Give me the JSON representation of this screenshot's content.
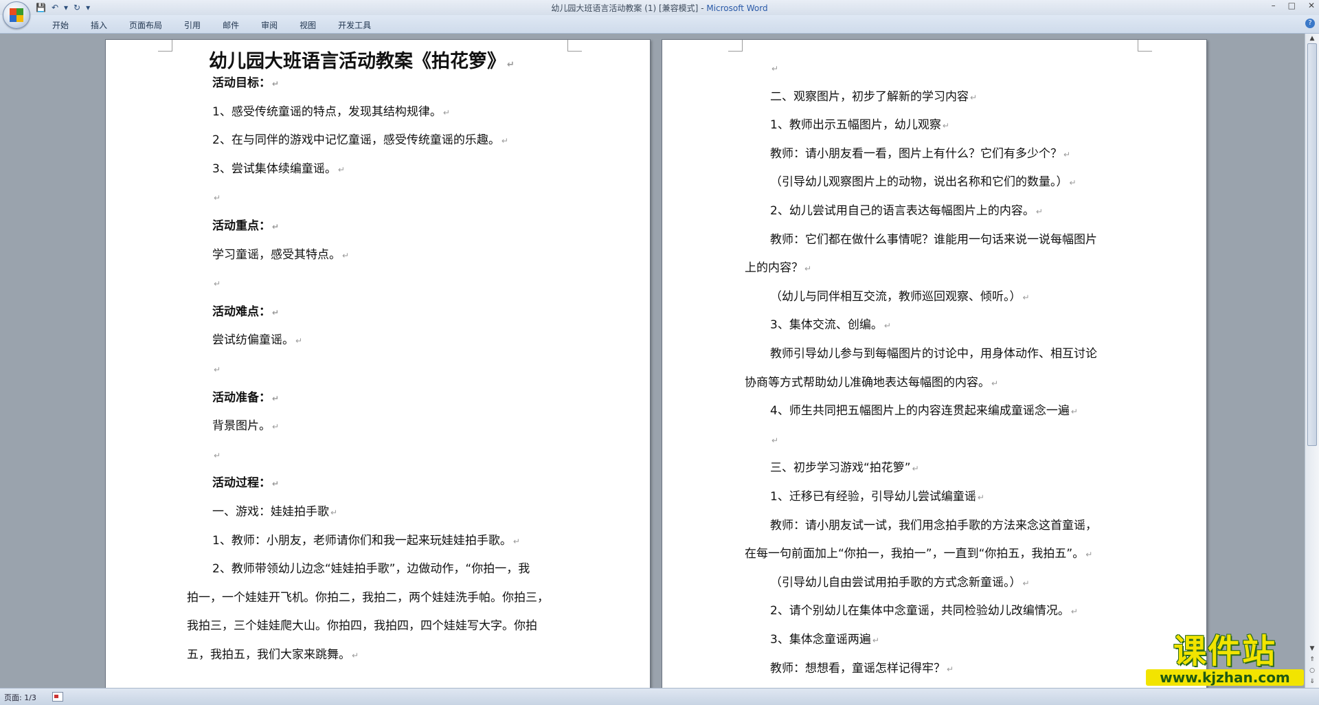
{
  "window": {
    "title": "幼儿园大班语言活动教案 (1) [兼容模式]",
    "title_separator": " - ",
    "app_name": "Microsoft Word",
    "qat": {
      "save_icon": "💾",
      "undo_icon": "↶",
      "undo_drop": "▾",
      "redo_icon": "↻",
      "customize_icon": "▾"
    },
    "controls": {
      "minimize": "–",
      "maximize": "□",
      "close": "✕"
    }
  },
  "ribbon": {
    "tabs": [
      {
        "label": "开始"
      },
      {
        "label": "插入"
      },
      {
        "label": "页面布局"
      },
      {
        "label": "引用"
      },
      {
        "label": "邮件"
      },
      {
        "label": "审阅"
      },
      {
        "label": "视图"
      },
      {
        "label": "开发工具"
      }
    ],
    "help_icon": "?"
  },
  "document": {
    "paragraph_mark": "↵",
    "left_page": {
      "title": "幼儿园大班语言活动教案《拍花箩》",
      "lines": [
        {
          "text": "活动目标：",
          "bold": true
        },
        {
          "text": "1、感受传统童谣的特点，发现其结构规律。"
        },
        {
          "text": "2、在与同伴的游戏中记忆童谣，感受传统童谣的乐趣。"
        },
        {
          "text": "3、尝试集体续编童谣。"
        },
        {
          "text": ""
        },
        {
          "text": "活动重点：",
          "bold": true
        },
        {
          "text": "学习童谣，感受其特点。"
        },
        {
          "text": ""
        },
        {
          "text": "活动难点：",
          "bold": true
        },
        {
          "text": "尝试纺偏童谣。"
        },
        {
          "text": ""
        },
        {
          "text": "活动准备：",
          "bold": true
        },
        {
          "text": "背景图片。"
        },
        {
          "text": ""
        },
        {
          "text": "活动过程：",
          "bold": true
        },
        {
          "text": "一、游戏：娃娃拍手歌"
        },
        {
          "text": "1、教师：小朋友，老师请你们和我一起来玩娃娃拍手歌。"
        },
        {
          "text": "2、教师带领幼儿边念“娃娃拍手歌”，边做动作，“你拍一，我",
          "nomark": true
        },
        {
          "text": "拍一，一个娃娃开飞机。你拍二，我拍二，两个娃娃洗手帕。你拍三，",
          "nomark": true,
          "wrap": true
        },
        {
          "text": "我拍三，三个娃娃爬大山。你拍四，我拍四，四个娃娃写大字。你拍",
          "nomark": true,
          "wrap": true
        },
        {
          "text": "五，我拍五，我们大家来跳舞。",
          "wrap": true
        }
      ]
    },
    "right_page": {
      "lines": [
        {
          "text": ""
        },
        {
          "text": "二、观察图片，初步了解新的学习内容"
        },
        {
          "text": "1、教师出示五幅图片，幼儿观察"
        },
        {
          "text": "教师：请小朋友看一看，图片上有什么？它们有多少个？"
        },
        {
          "text": "（引导幼儿观察图片上的动物，说出名称和它们的数量。）"
        },
        {
          "text": "2、幼儿尝试用自己的语言表达每幅图片上的内容。"
        },
        {
          "text": "教师：它们都在做什么事情呢？谁能用一句话来说一说每幅图片",
          "nomark": true
        },
        {
          "text": "上的内容？",
          "wrap": true
        },
        {
          "text": "（幼儿与同伴相互交流，教师巡回观察、倾听。）"
        },
        {
          "text": "3、集体交流、创编。"
        },
        {
          "text": "教师引导幼儿参与到每幅图片的讨论中，用身体动作、相互讨论",
          "nomark": true
        },
        {
          "text": "协商等方式帮助幼儿准确地表达每幅图的内容。",
          "wrap": true
        },
        {
          "text": "4、师生共同把五幅图片上的内容连贯起来编成童谣念一遍"
        },
        {
          "text": ""
        },
        {
          "text": "三、初步学习游戏“拍花箩”"
        },
        {
          "text": "1、迁移已有经验，引导幼儿尝试编童谣"
        },
        {
          "text": "教师：请小朋友试一试，我们用念拍手歌的方法来念这首童谣，",
          "nomark": true
        },
        {
          "text": "在每一句前面加上“你拍一，我拍一”，一直到“你拍五，我拍五”。",
          "wrap": true
        },
        {
          "text": "（引导幼儿自由尝试用拍手歌的方式念新童谣。）"
        },
        {
          "text": "2、请个别幼儿在集体中念童谣，共同检验幼儿改编情况。"
        },
        {
          "text": "3、集体念童谣两遍"
        },
        {
          "text": "教师：想想看，童谣怎样记得牢？"
        }
      ]
    }
  },
  "scrollbar": {
    "up_icon": "▲",
    "down_icon": "▼",
    "prev_icon": "⇑",
    "next_icon": "⇓",
    "browse_icon": "○"
  },
  "status": {
    "page": "页面: 1/3"
  },
  "watermark": {
    "main": "课件站",
    "sub": "www.kjzhan.com"
  },
  "colors": {
    "office_logo": [
      "#e84c1e",
      "#3a9a2c",
      "#2a6ac8",
      "#f2b705"
    ]
  }
}
